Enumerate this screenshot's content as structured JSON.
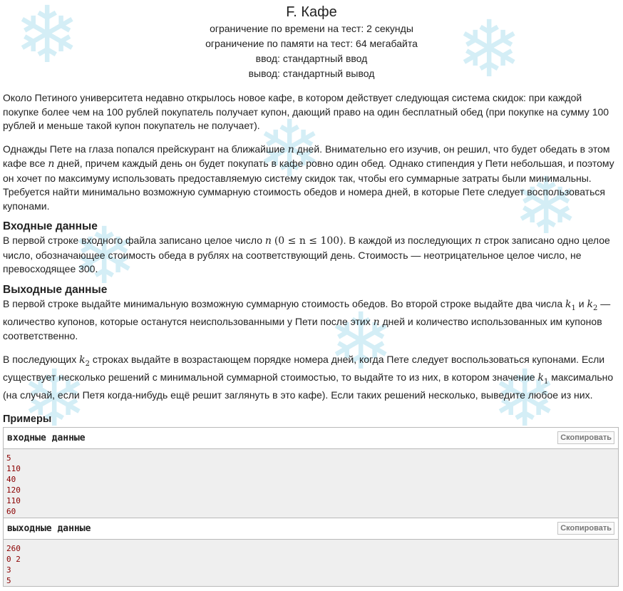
{
  "problem": {
    "title": "F. Кафе",
    "limits": {
      "time": "ограничение по времени на тест: 2 секунды",
      "memory": "ограничение по памяти на тест: 64 мегабайта",
      "input": "ввод: стандартный ввод",
      "output": "вывод: стандартный вывод"
    },
    "statement_p1": "Около Петиного университета недавно открылось новое кафе, в котором действует следующая система скидок: при каждой покупке более чем на 100 рублей покупатель получает купон, дающий право на один бесплатный обед (при покупке на сумму 100 рублей и меньше такой купон покупатель не получает).",
    "statement_p2": {
      "a": "Однажды Пете на глаза попался прейскурант на ближайшие ",
      "n1": "n",
      "b": " дней. Внимательно его изучив, он решил, что будет обедать в этом кафе все ",
      "n2": "n",
      "c": " дней, причем каждый день он будет покупать в кафе ровно один обед. Однако стипендия у Пети небольшая, и поэтому он хочет по максимуму использовать предоставляемую систему скидок так, чтобы его суммарные затраты были минимальны. Требуется найти минимально возможную суммарную стоимость обедов и номера дней, в которые Пете следует воспользоваться купонами."
    },
    "input_section": {
      "title": "Входные данные",
      "a": "В первой строке входного файла записано целое число ",
      "n1": "n",
      "formula": "(0 ≤ n ≤ 100)",
      "b": ". В каждой из последующих ",
      "n2": "n",
      "c": " строк записано одно целое число, обозначающее стоимость обеда в рублях на соответствующий день. Стоимость — неотрицательное целое число, не превосходящее 300."
    },
    "output_section": {
      "title": "Выходные данные",
      "p1": {
        "a": "В первой строке выдайте минимальную возможную суммарную стоимость обедов. Во второй строке выдайте два числа ",
        "k1": "k",
        "k1sub": "1",
        "and": " и ",
        "k2": "k",
        "k2sub": "2",
        "b": " — количество купонов, которые останутся неиспользованными у Пети после этих ",
        "n": "n",
        "c": " дней и количество использованных им купонов соответственно."
      },
      "p2": {
        "a": "В последующих ",
        "k2": "k",
        "k2sub": "2",
        "b": " строках выдайте в возрастающем порядке номера дней, когда Пете следует воспользоваться купонами. Если существует несколько решений с минимальной суммарной стоимостью, то выдайте то из них, в котором значение ",
        "k1": "k",
        "k1sub": "1",
        "c": " максимально (на случай, если Петя когда-нибудь ещё решит заглянуть в это кафе). Если таких решений несколько, выведите любое из них."
      }
    },
    "examples": {
      "title": "Примеры",
      "input_label": "входные данные",
      "output_label": "выходные данные",
      "copy_label": "Скопировать",
      "input_lines": [
        "5",
        "110",
        "40",
        "120",
        "110",
        "60"
      ],
      "output_lines": [
        "260",
        "0 2",
        "3",
        "5"
      ]
    }
  }
}
